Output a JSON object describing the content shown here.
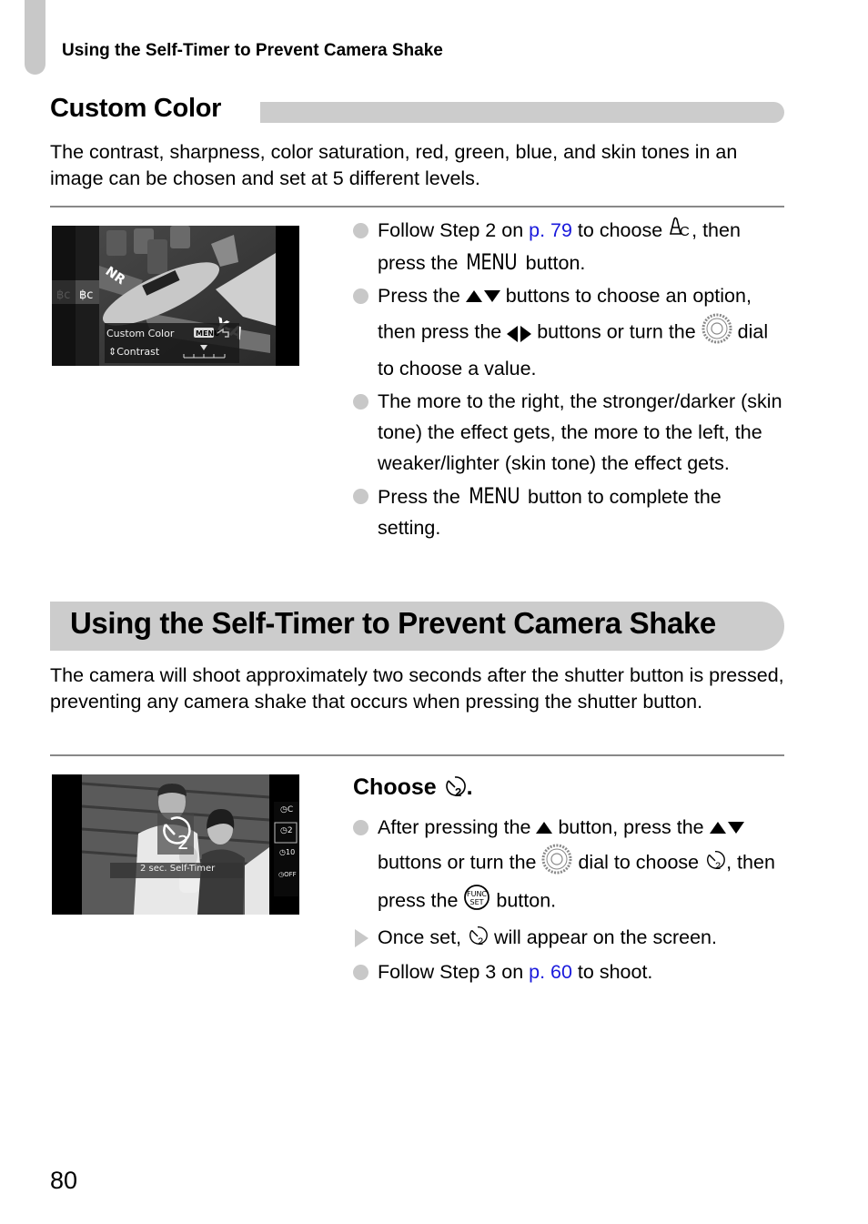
{
  "running_head": "Using the Self-Timer to Prevent Camera Shake",
  "custom_color": {
    "heading": "Custom Color",
    "intro": "The contrast, sharpness, color saturation, red, green, blue, and skin tones in an image can be chosen and set at 5 different levels.",
    "screen": {
      "menu_label": "Custom Color",
      "option_label": "Contrast",
      "menu_button": "MENU",
      "slider_level": 3,
      "slider_levels": 5
    },
    "steps": [
      {
        "pre": "Follow Step 2 on ",
        "link": "p. 79",
        "mid": " to choose ",
        "icon": "custom-color-icon",
        "post1": ", then press the ",
        "key": "MENU",
        "post2": " button."
      },
      {
        "pre": "Press the ",
        "icons": "up-down-buttons",
        "mid": " buttons to choose an option, then press the ",
        "icons2": "left-right-buttons",
        "mid2": " buttons or turn the ",
        "dial": "control-dial",
        "post": " dial to choose a value."
      },
      {
        "text": "The more to the right, the stronger/darker (skin tone) the effect gets, the more to the left, the weaker/lighter (skin tone) the effect gets."
      },
      {
        "pre": "Press the ",
        "key": "MENU",
        "post": " button to complete the setting."
      }
    ]
  },
  "self_timer": {
    "heading": "Using the Self-Timer to Prevent Camera Shake",
    "intro": "The camera will shoot approximately two seconds after the shutter button is pressed, preventing any camera shake that occurs when pressing the shutter button.",
    "screen": {
      "caption": "2 sec. Self-Timer",
      "menu_options": [
        "C",
        "2",
        "10",
        "OFF"
      ],
      "selected_option": "2"
    },
    "choose_label": "Choose",
    "steps": [
      {
        "pre": "After pressing the ",
        "mid": " button, press the ",
        "mid2": " buttons or turn the ",
        "mid3": " dial to choose ",
        "mid4": ", then press the ",
        "func": "FUNC SET",
        "post": " button."
      },
      {
        "pre": "Once set, ",
        "post": " will appear on the screen."
      },
      {
        "pre": "Follow Step 3 on ",
        "link": "p. 60",
        "post": " to shoot."
      }
    ]
  },
  "page_number": "80",
  "colors": {
    "link": "#1a1adc",
    "gray_bar": "#cccccc",
    "bullet": "#c8c8c8",
    "rule": "#888888"
  }
}
